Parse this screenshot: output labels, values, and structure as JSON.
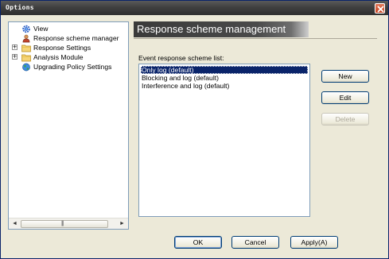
{
  "window": {
    "title": "Options"
  },
  "tree": {
    "items": [
      {
        "label": "View",
        "icon": "gear-icon",
        "expandable": false
      },
      {
        "label": "Response scheme manager",
        "icon": "user-icon",
        "expandable": false
      },
      {
        "label": "Response Settings",
        "icon": "folder-icon",
        "expandable": true,
        "expander": "+"
      },
      {
        "label": "Analysis Module",
        "icon": "folder-icon",
        "expandable": true,
        "expander": "+"
      },
      {
        "label": "Upgrading Policy Settings",
        "icon": "globe-icon",
        "expandable": false
      }
    ],
    "scroll_left": "◄",
    "scroll_right": "►",
    "scroll_grip": "|||"
  },
  "panel": {
    "title": "Response scheme management",
    "list_label": "Event response scheme list:",
    "schemes": [
      {
        "label": "Only log (default)",
        "selected": true
      },
      {
        "label": "Blocking and log (default)",
        "selected": false
      },
      {
        "label": "Interference and log (default)",
        "selected": false
      }
    ],
    "buttons": {
      "new": "New",
      "edit": "Edit",
      "delete": "Delete"
    }
  },
  "footer": {
    "ok": "OK",
    "cancel": "Cancel",
    "apply": "Apply(A)"
  },
  "colors": {
    "titlebar": "#404040",
    "selection": "#0a246a",
    "header": "#3a3a3a",
    "dialog_bg": "#ece9d8"
  }
}
